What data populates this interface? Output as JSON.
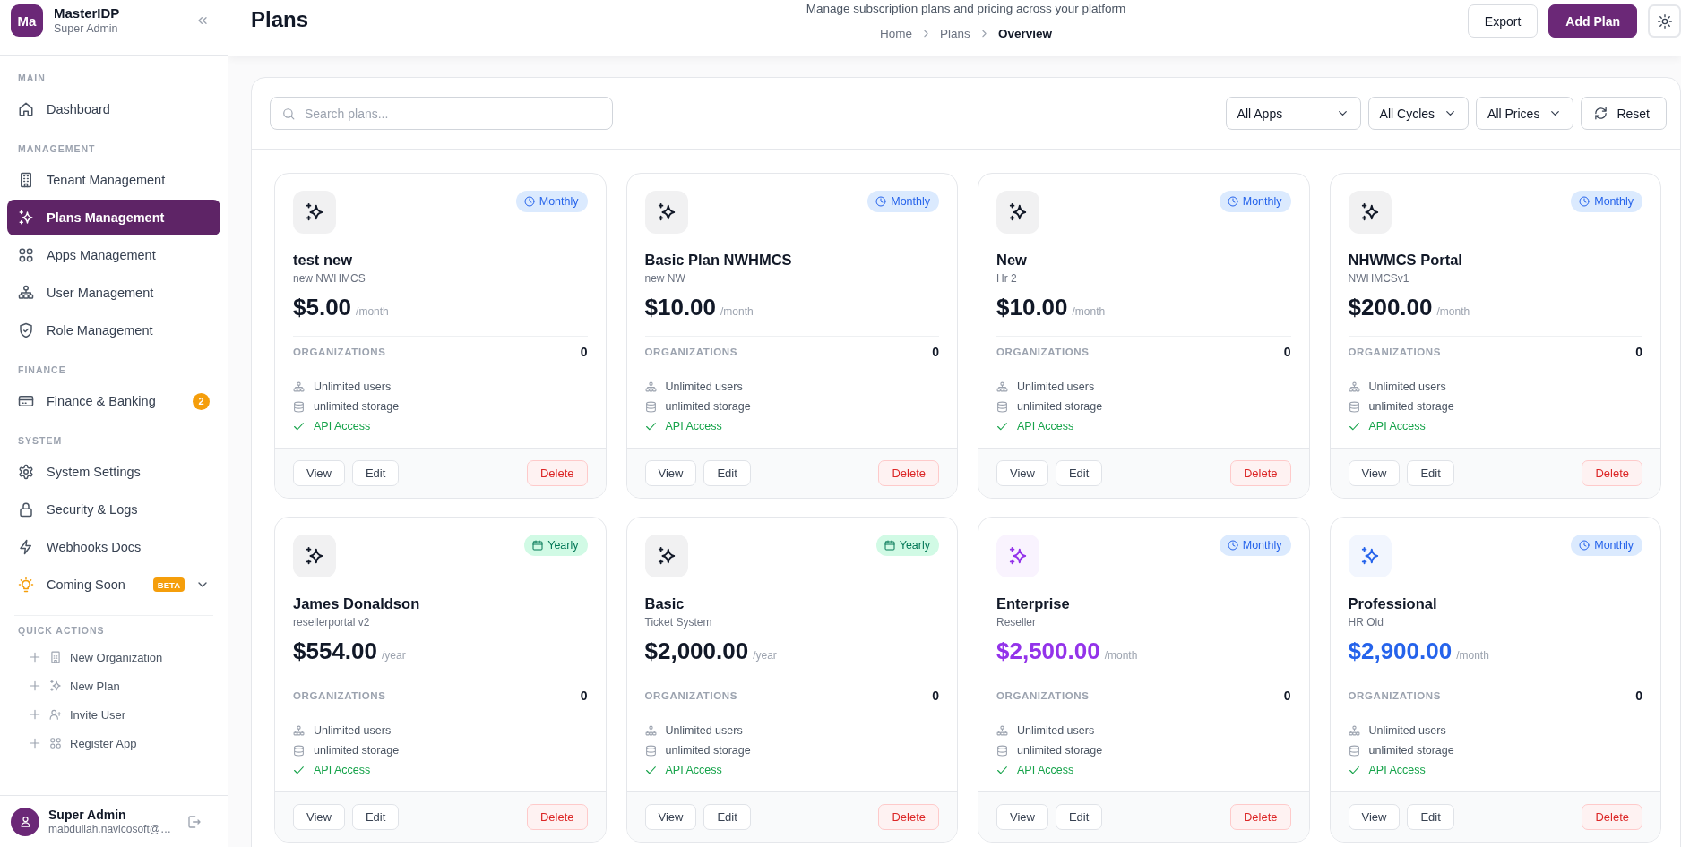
{
  "sidebar": {
    "brand": {
      "initials": "Ma",
      "name": "MasterIDP",
      "role": "Super Admin"
    },
    "sections": [
      {
        "title": "MAIN",
        "items": [
          {
            "label": "Dashboard",
            "kind": "dashboard",
            "selected": false
          }
        ]
      },
      {
        "title": "MANAGEMENT",
        "items": [
          {
            "label": "Tenant Management",
            "kind": "tenants",
            "selected": false
          },
          {
            "label": "Plans Management",
            "kind": "plans",
            "selected": true
          },
          {
            "label": "Apps Management",
            "kind": "apps",
            "selected": false
          },
          {
            "label": "User Management",
            "kind": "users",
            "selected": false
          },
          {
            "label": "Role Management",
            "kind": "roles",
            "selected": false
          }
        ]
      },
      {
        "title": "FINANCE",
        "items": [
          {
            "label": "Finance & Banking",
            "kind": "finance",
            "selected": false,
            "badge": "2"
          }
        ]
      },
      {
        "title": "SYSTEM",
        "items": [
          {
            "label": "System Settings",
            "kind": "settings",
            "selected": false
          },
          {
            "label": "Security & Logs",
            "kind": "security",
            "selected": false
          },
          {
            "label": "Webhooks Docs",
            "kind": "webhooks",
            "selected": false
          },
          {
            "label": "Coming Soon",
            "kind": "upcoming",
            "selected": false,
            "tag": "BETA",
            "expanded": false
          }
        ]
      }
    ],
    "quick_actions": {
      "title": "QUICK ACTIONS",
      "items": [
        {
          "label": "New Organization",
          "kind": "organization"
        },
        {
          "label": "New Plan",
          "kind": "plan"
        },
        {
          "label": "Invite User",
          "kind": "user"
        },
        {
          "label": "Register App",
          "kind": "app"
        }
      ]
    },
    "user": {
      "name": "Super Admin",
      "email": "mabdullah.navicosoft@…"
    }
  },
  "header": {
    "title": "Plans",
    "subtitle": "Manage subscription plans and pricing across your platform",
    "breadcrumb": [
      {
        "label": "Home",
        "current": false
      },
      {
        "label": "Plans",
        "current": false
      },
      {
        "label": "Overview",
        "current": true
      }
    ],
    "actions": [
      {
        "label": "Export",
        "kind": "export"
      },
      {
        "label": "Add Plan",
        "kind": "add"
      }
    ]
  },
  "toolbar": {
    "search": {
      "placeholder": "Search plans..."
    },
    "filters": [
      {
        "value": "All Apps"
      },
      {
        "value": "All Cycles"
      },
      {
        "value": "All Prices"
      }
    ],
    "reset": {
      "label": "Reset"
    }
  },
  "plans": [
    {
      "name": "test new",
      "subtitle": "new NWHMCS",
      "price": "$5.00",
      "period": "/month",
      "color": "#111827",
      "cycle": {
        "label": "Monthly",
        "kind": "monthly"
      },
      "stat": {
        "label": "ORGANIZATIONS",
        "value": "0"
      },
      "features": [
        {
          "text": "Unlimited users",
          "kind": "users"
        },
        {
          "text": "unlimited storage",
          "kind": "storage"
        },
        {
          "text": "API Access",
          "kind": "included"
        }
      ],
      "actions": [
        {
          "label": "View",
          "kind": "view"
        },
        {
          "label": "Edit",
          "kind": "edit"
        },
        {
          "label": "Delete",
          "kind": "delete"
        }
      ]
    },
    {
      "name": "Basic Plan NWHMCS",
      "subtitle": "new NW",
      "price": "$10.00",
      "period": "/month",
      "color": "#111827",
      "cycle": {
        "label": "Monthly",
        "kind": "monthly"
      },
      "stat": {
        "label": "ORGANIZATIONS",
        "value": "0"
      },
      "features": [
        {
          "text": "Unlimited users",
          "kind": "users"
        },
        {
          "text": "unlimited storage",
          "kind": "storage"
        },
        {
          "text": "API Access",
          "kind": "included"
        }
      ],
      "actions": [
        {
          "label": "View",
          "kind": "view"
        },
        {
          "label": "Edit",
          "kind": "edit"
        },
        {
          "label": "Delete",
          "kind": "delete"
        }
      ]
    },
    {
      "name": "New",
      "subtitle": "Hr 2",
      "price": "$10.00",
      "period": "/month",
      "color": "#111827",
      "cycle": {
        "label": "Monthly",
        "kind": "monthly"
      },
      "stat": {
        "label": "ORGANIZATIONS",
        "value": "0"
      },
      "features": [
        {
          "text": "Unlimited users",
          "kind": "users"
        },
        {
          "text": "unlimited storage",
          "kind": "storage"
        },
        {
          "text": "API Access",
          "kind": "included"
        }
      ],
      "actions": [
        {
          "label": "View",
          "kind": "view"
        },
        {
          "label": "Edit",
          "kind": "edit"
        },
        {
          "label": "Delete",
          "kind": "delete"
        }
      ]
    },
    {
      "name": "NHWMCS Portal",
      "subtitle": "NWHMCSv1",
      "price": "$200.00",
      "period": "/month",
      "color": "#111827",
      "cycle": {
        "label": "Monthly",
        "kind": "monthly"
      },
      "stat": {
        "label": "ORGANIZATIONS",
        "value": "0"
      },
      "features": [
        {
          "text": "Unlimited users",
          "kind": "users"
        },
        {
          "text": "unlimited storage",
          "kind": "storage"
        },
        {
          "text": "API Access",
          "kind": "included"
        }
      ],
      "actions": [
        {
          "label": "View",
          "kind": "view"
        },
        {
          "label": "Edit",
          "kind": "edit"
        },
        {
          "label": "Delete",
          "kind": "delete"
        }
      ]
    },
    {
      "name": "James Donaldson",
      "subtitle": "resellerportal v2",
      "price": "$554.00",
      "period": "/year",
      "color": "#111827",
      "cycle": {
        "label": "Yearly",
        "kind": "yearly"
      },
      "stat": {
        "label": "ORGANIZATIONS",
        "value": "0"
      },
      "features": [
        {
          "text": "Unlimited users",
          "kind": "users"
        },
        {
          "text": "unlimited storage",
          "kind": "storage"
        },
        {
          "text": "API Access",
          "kind": "included"
        }
      ],
      "actions": [
        {
          "label": "View",
          "kind": "view"
        },
        {
          "label": "Edit",
          "kind": "edit"
        },
        {
          "label": "Delete",
          "kind": "delete"
        }
      ]
    },
    {
      "name": "Basic",
      "subtitle": "Ticket System",
      "price": "$2,000.00",
      "period": "/year",
      "color": "#111827",
      "cycle": {
        "label": "Yearly",
        "kind": "yearly"
      },
      "stat": {
        "label": "ORGANIZATIONS",
        "value": "0"
      },
      "features": [
        {
          "text": "Unlimited users",
          "kind": "users"
        },
        {
          "text": "unlimited storage",
          "kind": "storage"
        },
        {
          "text": "API Access",
          "kind": "included"
        }
      ],
      "actions": [
        {
          "label": "View",
          "kind": "view"
        },
        {
          "label": "Edit",
          "kind": "edit"
        },
        {
          "label": "Delete",
          "kind": "delete"
        }
      ]
    },
    {
      "name": "Enterprise",
      "subtitle": "Reseller",
      "price": "$2,500.00",
      "period": "/month",
      "color": "#9333ea",
      "cycle": {
        "label": "Monthly",
        "kind": "monthly"
      },
      "stat": {
        "label": "ORGANIZATIONS",
        "value": "0"
      },
      "features": [
        {
          "text": "Unlimited users",
          "kind": "users"
        },
        {
          "text": "unlimited storage",
          "kind": "storage"
        },
        {
          "text": "API Access",
          "kind": "included"
        }
      ],
      "actions": [
        {
          "label": "View",
          "kind": "view"
        },
        {
          "label": "Edit",
          "kind": "edit"
        },
        {
          "label": "Delete",
          "kind": "delete"
        }
      ]
    },
    {
      "name": "Professional",
      "subtitle": "HR Old",
      "price": "$2,900.00",
      "period": "/month",
      "color": "#2563eb",
      "cycle": {
        "label": "Monthly",
        "kind": "monthly"
      },
      "stat": {
        "label": "ORGANIZATIONS",
        "value": "0"
      },
      "features": [
        {
          "text": "Unlimited users",
          "kind": "users"
        },
        {
          "text": "unlimited storage",
          "kind": "storage"
        },
        {
          "text": "API Access",
          "kind": "included"
        }
      ],
      "actions": [
        {
          "label": "View",
          "kind": "view"
        },
        {
          "label": "Edit",
          "kind": "edit"
        },
        {
          "label": "Delete",
          "kind": "delete"
        }
      ]
    }
  ]
}
